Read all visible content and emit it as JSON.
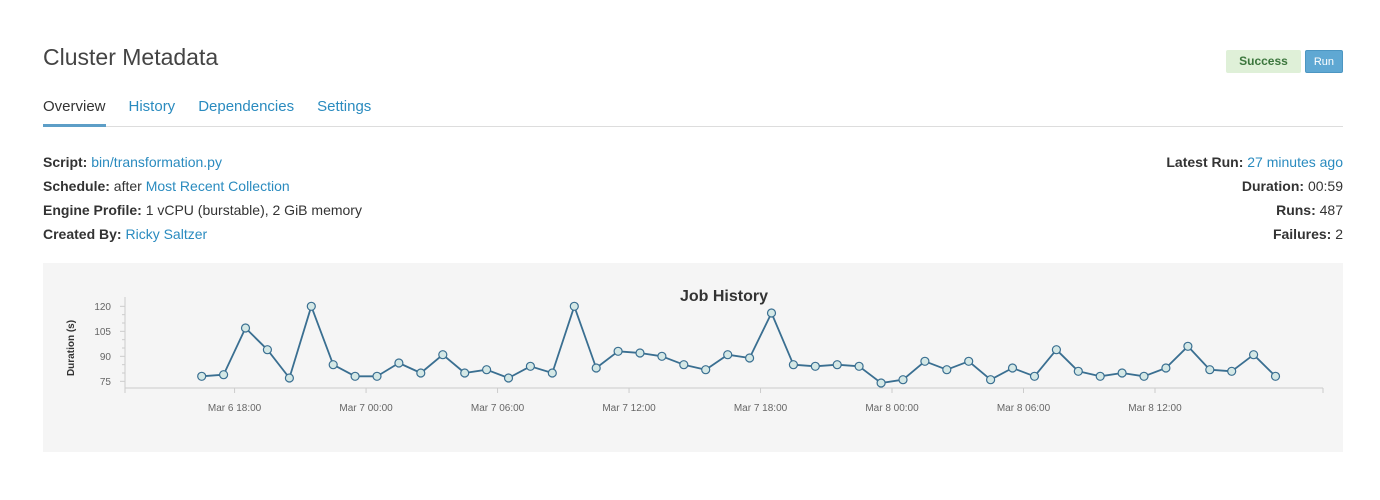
{
  "header": {
    "title": "Cluster Metadata",
    "status_badge": "Success",
    "run_button": "Run"
  },
  "tabs": [
    {
      "label": "Overview",
      "active": true
    },
    {
      "label": "History",
      "active": false
    },
    {
      "label": "Dependencies",
      "active": false
    },
    {
      "label": "Settings",
      "active": false
    }
  ],
  "meta_left": {
    "script_label": "Script:",
    "script_value": "bin/transformation.py",
    "schedule_label": "Schedule:",
    "schedule_prefix": "after",
    "schedule_value": "Most Recent Collection",
    "engine_label": "Engine Profile:",
    "engine_value": "1 vCPU (burstable), 2 GiB memory",
    "created_label": "Created By:",
    "created_value": "Ricky Saltzer"
  },
  "meta_right": {
    "latest_label": "Latest Run:",
    "latest_value": "27 minutes ago",
    "duration_label": "Duration:",
    "duration_value": "00:59",
    "runs_label": "Runs:",
    "runs_value": "487",
    "failures_label": "Failures:",
    "failures_value": "2"
  },
  "colors": {
    "accent": "#2a8bbf",
    "success_bg": "#dff0d8",
    "success_text": "#3c763d",
    "line": "#3a6f91",
    "marker_fill": "#d4e8e6"
  },
  "chart_data": {
    "type": "line",
    "title": "Job History",
    "ylabel": "Duration (s)",
    "xlabel": "",
    "ylim": [
      71,
      122
    ],
    "xlim": [
      "2019-03-06 13:00",
      "2019-03-08 19:40"
    ],
    "yticks": [
      75,
      90,
      105,
      120
    ],
    "xticks": [
      {
        "t": "2019-03-06 18:00",
        "label": "Mar 6 18:00"
      },
      {
        "t": "2019-03-07 00:00",
        "label": "Mar 7 00:00"
      },
      {
        "t": "2019-03-07 06:00",
        "label": "Mar 7 06:00"
      },
      {
        "t": "2019-03-07 12:00",
        "label": "Mar 7 12:00"
      },
      {
        "t": "2019-03-07 18:00",
        "label": "Mar 7 18:00"
      },
      {
        "t": "2019-03-08 00:00",
        "label": "Mar 8 00:00"
      },
      {
        "t": "2019-03-08 06:00",
        "label": "Mar 8 06:00"
      },
      {
        "t": "2019-03-08 12:00",
        "label": "Mar 8 12:00"
      }
    ],
    "grid": false,
    "series": [
      {
        "x": [
          "2019-03-06 16:30",
          "2019-03-06 17:30",
          "2019-03-06 18:30",
          "2019-03-06 19:30",
          "2019-03-06 20:30",
          "2019-03-06 21:30",
          "2019-03-06 22:30",
          "2019-03-06 23:30",
          "2019-03-07 00:30",
          "2019-03-07 01:30",
          "2019-03-07 02:30",
          "2019-03-07 03:30",
          "2019-03-07 04:30",
          "2019-03-07 05:30",
          "2019-03-07 06:30",
          "2019-03-07 07:30",
          "2019-03-07 08:30",
          "2019-03-07 09:30",
          "2019-03-07 10:30",
          "2019-03-07 11:30",
          "2019-03-07 12:30",
          "2019-03-07 13:30",
          "2019-03-07 14:30",
          "2019-03-07 15:30",
          "2019-03-07 16:30",
          "2019-03-07 17:30",
          "2019-03-07 18:30",
          "2019-03-07 19:30",
          "2019-03-07 20:30",
          "2019-03-07 21:30",
          "2019-03-07 22:30",
          "2019-03-07 23:30",
          "2019-03-08 00:30",
          "2019-03-08 01:30",
          "2019-03-08 02:30",
          "2019-03-08 03:30",
          "2019-03-08 04:30",
          "2019-03-08 05:30",
          "2019-03-08 06:30",
          "2019-03-08 07:30",
          "2019-03-08 08:30",
          "2019-03-08 09:30",
          "2019-03-08 10:30",
          "2019-03-08 11:30",
          "2019-03-08 12:30",
          "2019-03-08 13:30",
          "2019-03-08 14:30",
          "2019-03-08 15:30",
          "2019-03-08 16:30",
          "2019-03-08 17:30"
        ],
        "values": [
          78,
          79,
          107,
          94,
          77,
          120,
          85,
          78,
          78,
          86,
          80,
          91,
          80,
          82,
          77,
          84,
          80,
          120,
          83,
          93,
          92,
          90,
          85,
          82,
          91,
          89,
          116,
          85,
          84,
          85,
          84,
          74,
          76,
          87,
          82,
          87,
          76,
          83,
          78,
          94,
          81,
          78,
          80,
          78,
          83,
          96,
          82,
          81,
          91,
          78
        ]
      }
    ]
  }
}
